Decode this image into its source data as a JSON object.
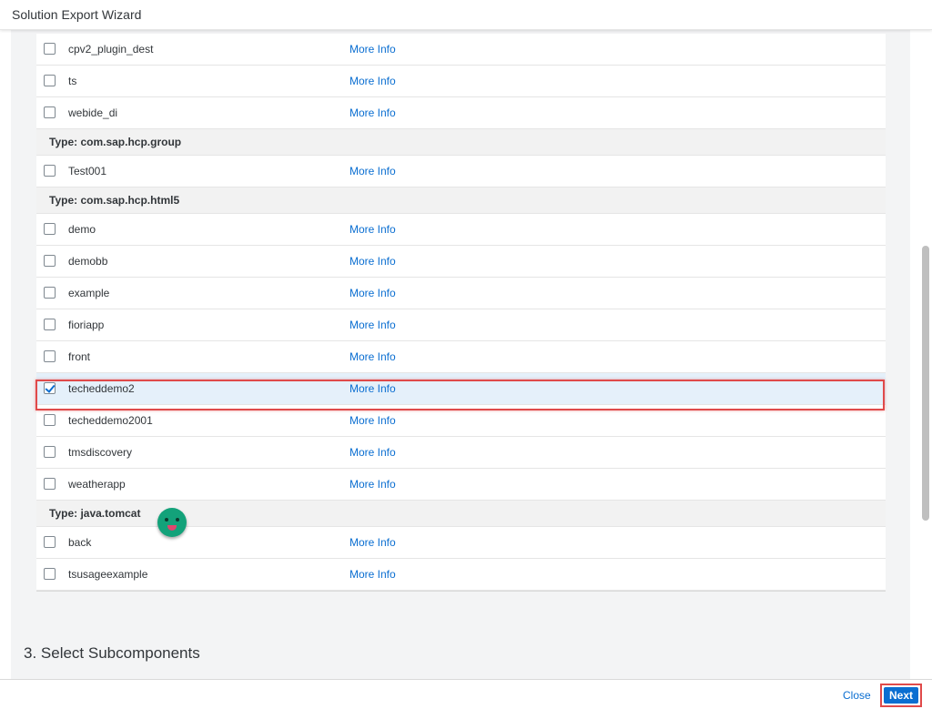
{
  "window": {
    "title": "Solution Export Wizard"
  },
  "rows": [
    {
      "kind": "item",
      "name": "cpv2_plugin_dest",
      "link": "More Info",
      "checked": false
    },
    {
      "kind": "item",
      "name": "ts",
      "link": "More Info",
      "checked": false
    },
    {
      "kind": "item",
      "name": "webide_di",
      "link": "More Info",
      "checked": false
    },
    {
      "kind": "group",
      "label": "Type: com.sap.hcp.group"
    },
    {
      "kind": "item",
      "name": "Test001",
      "link": "More Info",
      "checked": false
    },
    {
      "kind": "group",
      "label": "Type: com.sap.hcp.html5"
    },
    {
      "kind": "item",
      "name": "demo",
      "link": "More Info",
      "checked": false
    },
    {
      "kind": "item",
      "name": "demobb",
      "link": "More Info",
      "checked": false
    },
    {
      "kind": "item",
      "name": "example",
      "link": "More Info",
      "checked": false
    },
    {
      "kind": "item",
      "name": "fioriapp",
      "link": "More Info",
      "checked": false
    },
    {
      "kind": "item",
      "name": "front",
      "link": "More Info",
      "checked": false
    },
    {
      "kind": "item",
      "name": "techeddemo2",
      "link": "More Info",
      "checked": true
    },
    {
      "kind": "item",
      "name": "techeddemo2001",
      "link": "More Info",
      "checked": false
    },
    {
      "kind": "item",
      "name": "tmsdiscovery",
      "link": "More Info",
      "checked": false
    },
    {
      "kind": "item",
      "name": "weatherapp",
      "link": "More Info",
      "checked": false
    },
    {
      "kind": "group",
      "label": "Type: java.tomcat"
    },
    {
      "kind": "item",
      "name": "back",
      "link": "More Info",
      "checked": false
    },
    {
      "kind": "item",
      "name": "tsusageexample",
      "link": "More Info",
      "checked": false
    }
  ],
  "section": {
    "title": "3. Select Subcomponents"
  },
  "footer": {
    "close_label": "Close",
    "next_label": "Next"
  },
  "colors": {
    "accent": "#0a6ed1",
    "highlight": "#e04a4a",
    "mascot": "#13a27a"
  }
}
